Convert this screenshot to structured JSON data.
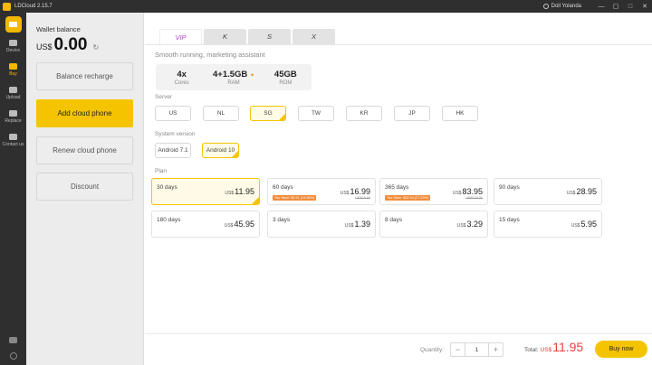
{
  "window": {
    "title": "LDCloud 2.15.7",
    "user_name": "Doll Yolanda",
    "buttons": [
      "—",
      "▢",
      "□",
      "✕"
    ]
  },
  "rail": {
    "items": [
      {
        "label": "Device",
        "icon": "device-icon"
      },
      {
        "label": "Buy",
        "icon": "cart-icon",
        "active": true
      },
      {
        "label": "Upload",
        "icon": "cloud-upload-icon"
      },
      {
        "label": "Replace",
        "icon": "replace-icon"
      },
      {
        "label": "Contact us",
        "icon": "contact-icon"
      }
    ]
  },
  "wallet": {
    "label": "Wallet balance",
    "currency": "US$",
    "amount": "0.00"
  },
  "left_buttons": {
    "balance_recharge": "Balance recharge",
    "add_cloud_phone": "Add cloud phone",
    "renew_cloud_phone": "Renew cloud phone",
    "discount": "Discount"
  },
  "tiers": {
    "tabs": [
      "VIP",
      "K",
      "S",
      "X"
    ],
    "active": "VIP",
    "subtitle": "Smooth running, marketing assistant"
  },
  "specs": [
    {
      "value": "4x",
      "label": "Cores"
    },
    {
      "value": "4+1.5GB",
      "label": "RAM",
      "badge": "✦"
    },
    {
      "value": "45GB",
      "label": "ROM"
    }
  ],
  "server": {
    "label": "Server",
    "options": [
      "US",
      "NL",
      "SG",
      "TW",
      "KR",
      "JP",
      "HK"
    ],
    "selected": "SG"
  },
  "system": {
    "label": "System version",
    "options": [
      "Android 7.1",
      "Android 10"
    ],
    "selected": "Android 10"
  },
  "plan": {
    "label": "Plan",
    "options": [
      {
        "days": "30 days",
        "currency": "US$",
        "price": "11.95",
        "original": "",
        "save": "",
        "selected": true
      },
      {
        "days": "60 days",
        "currency": "US$",
        "price": "16.99",
        "original": "US$19.90",
        "save": "You Save: $2.91 (14.66%)"
      },
      {
        "days": "365 days",
        "currency": "US$",
        "price": "83.95",
        "original": "US$119.00",
        "save": "You Save: $32.04 (27.63%)"
      },
      {
        "days": "90 days",
        "currency": "US$",
        "price": "28.95",
        "original": "",
        "save": ""
      },
      {
        "days": "180 days",
        "currency": "US$",
        "price": "45.95",
        "original": "",
        "save": ""
      },
      {
        "days": "3 days",
        "currency": "US$",
        "price": "1.39",
        "original": "",
        "save": ""
      },
      {
        "days": "8 days",
        "currency": "US$",
        "price": "3.29",
        "original": "",
        "save": ""
      },
      {
        "days": "15 days",
        "currency": "US$",
        "price": "5.95",
        "original": "",
        "save": ""
      }
    ]
  },
  "footer": {
    "quantity_label": "Quantity:",
    "quantity": "1",
    "minus": "−",
    "plus": "+",
    "total_label": "Total:",
    "total_currency": "US$",
    "total_value": "11.95",
    "buy_label": "Buy now"
  },
  "colors": {
    "accent": "#f5c400",
    "tab_active": "#b045c8",
    "price_total": "#e8413e",
    "save_badge": "#f08c3c"
  }
}
